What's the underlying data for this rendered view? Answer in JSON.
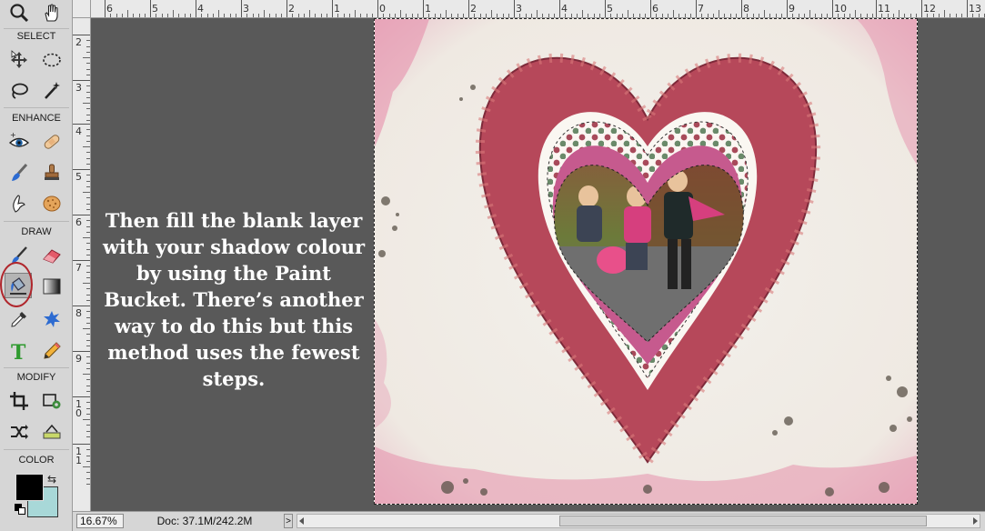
{
  "toolbox": {
    "sections": {
      "select": "SELECT",
      "enhance": "ENHANCE",
      "draw": "DRAW",
      "modify": "MODIFY",
      "color": "COLOR"
    },
    "selected_tool": "paint-bucket-tool",
    "highlight_color": "#b0262c",
    "foreground_color": "#000000",
    "background_color": "#a8d8d8"
  },
  "ruler": {
    "top_labels": [
      "6",
      "5",
      "4",
      "3",
      "2",
      "1",
      "0",
      "1",
      "2",
      "3",
      "4",
      "5",
      "6",
      "7",
      "8",
      "9",
      "10",
      "11",
      "12",
      "13"
    ],
    "left_labels": [
      "2",
      "3",
      "4",
      "5",
      "6",
      "7",
      "8",
      "9",
      "1\n0",
      "1\n1"
    ]
  },
  "instruction": {
    "text": "Then fill the blank layer with your shadow colour by using the Paint Bucket. There’s another way to do this but this method uses the fewest steps."
  },
  "status_bar": {
    "zoom": "16.67%",
    "doc_size": "Doc: 37.1M/242.2M",
    "arrow": ">"
  }
}
